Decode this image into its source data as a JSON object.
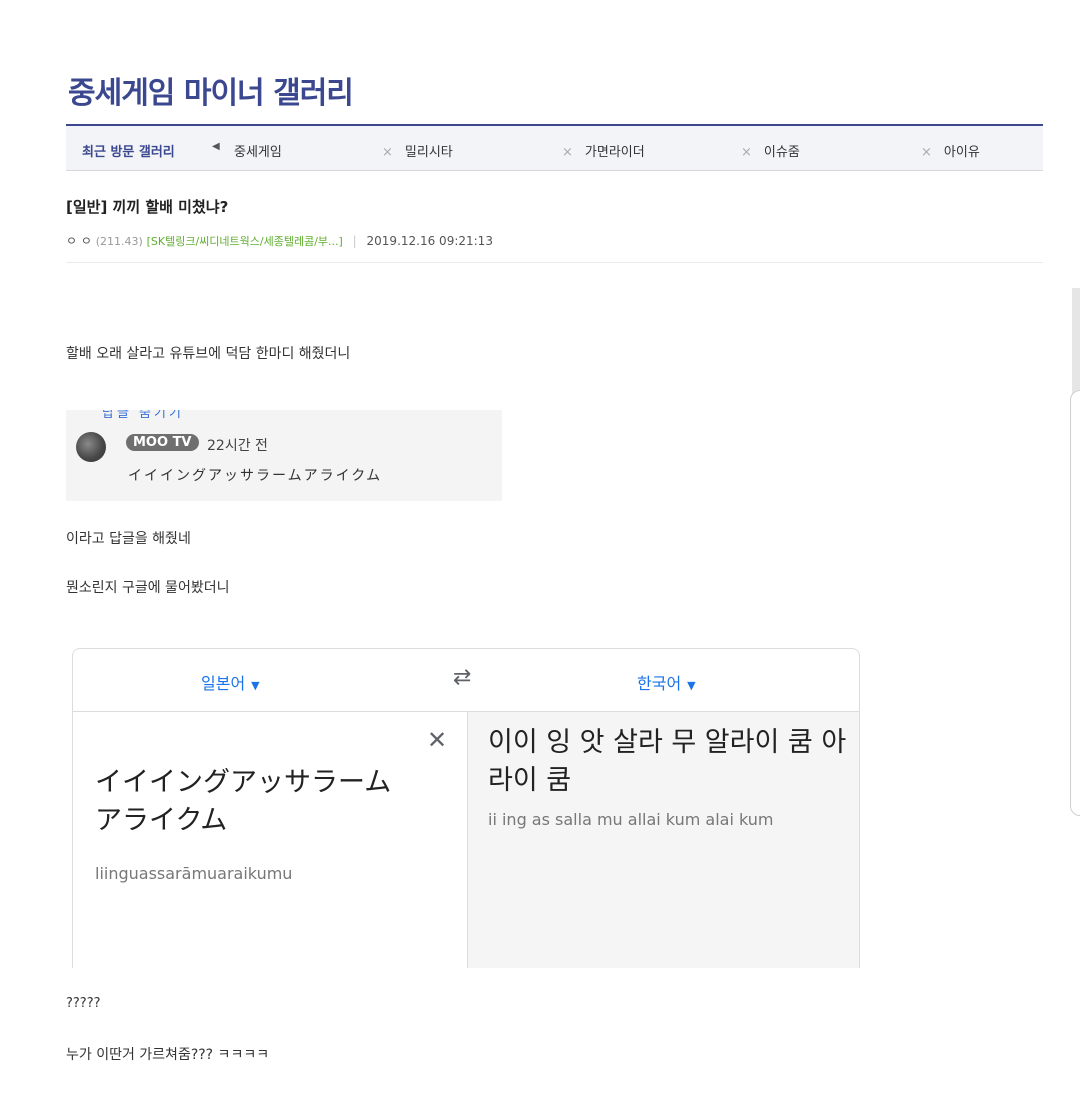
{
  "gallery": {
    "title": "중세게임 마이너 갤러리"
  },
  "recent": {
    "label": "최근 방문 갤러리",
    "arrow": "◀",
    "items": [
      "중세게임",
      "밀리시타",
      "가면라이더",
      "이슈줌",
      "아이유"
    ],
    "close_glyph": "×"
  },
  "post": {
    "title": "[일반] 끼끼 할배 미쳤냐?",
    "author": "ㅇ ㅇ",
    "ip": "(211.43)",
    "isp": "[SK텔링크/씨디네트웍스/세종텔레콤/부...]",
    "separator": "|",
    "date": "2019.12.16 09:21:13"
  },
  "content": {
    "line1": "할배 오래 살라고 유튜브에 덕담 한마디 해줬더니",
    "line2": "이라고 답글을 해줬네",
    "line3": "뭔소린지 구글에 물어봤더니",
    "line4": "?????",
    "line5": "누가 이딴거 가르쳐줌??? ㅋㅋㅋㅋ"
  },
  "comment": {
    "cut_text": "답글 숨기기",
    "badge": "MOO TV",
    "time": "22시간 전",
    "text": "イイイングアッサラームアライクム"
  },
  "translate": {
    "source_lang": "일본어",
    "target_lang": "한국어",
    "caret": "▼",
    "swap_glyph": "⇄",
    "close_glyph": "✕",
    "source_text": "イイイングアッサラームアライクム",
    "source_roman": "liinguassarāmuaraikumu",
    "target_text": "이이 잉 앗 살라 무 알라이 쿰 아라이 쿰",
    "target_roman": "ii ing as salla mu allai kum alai kum"
  }
}
